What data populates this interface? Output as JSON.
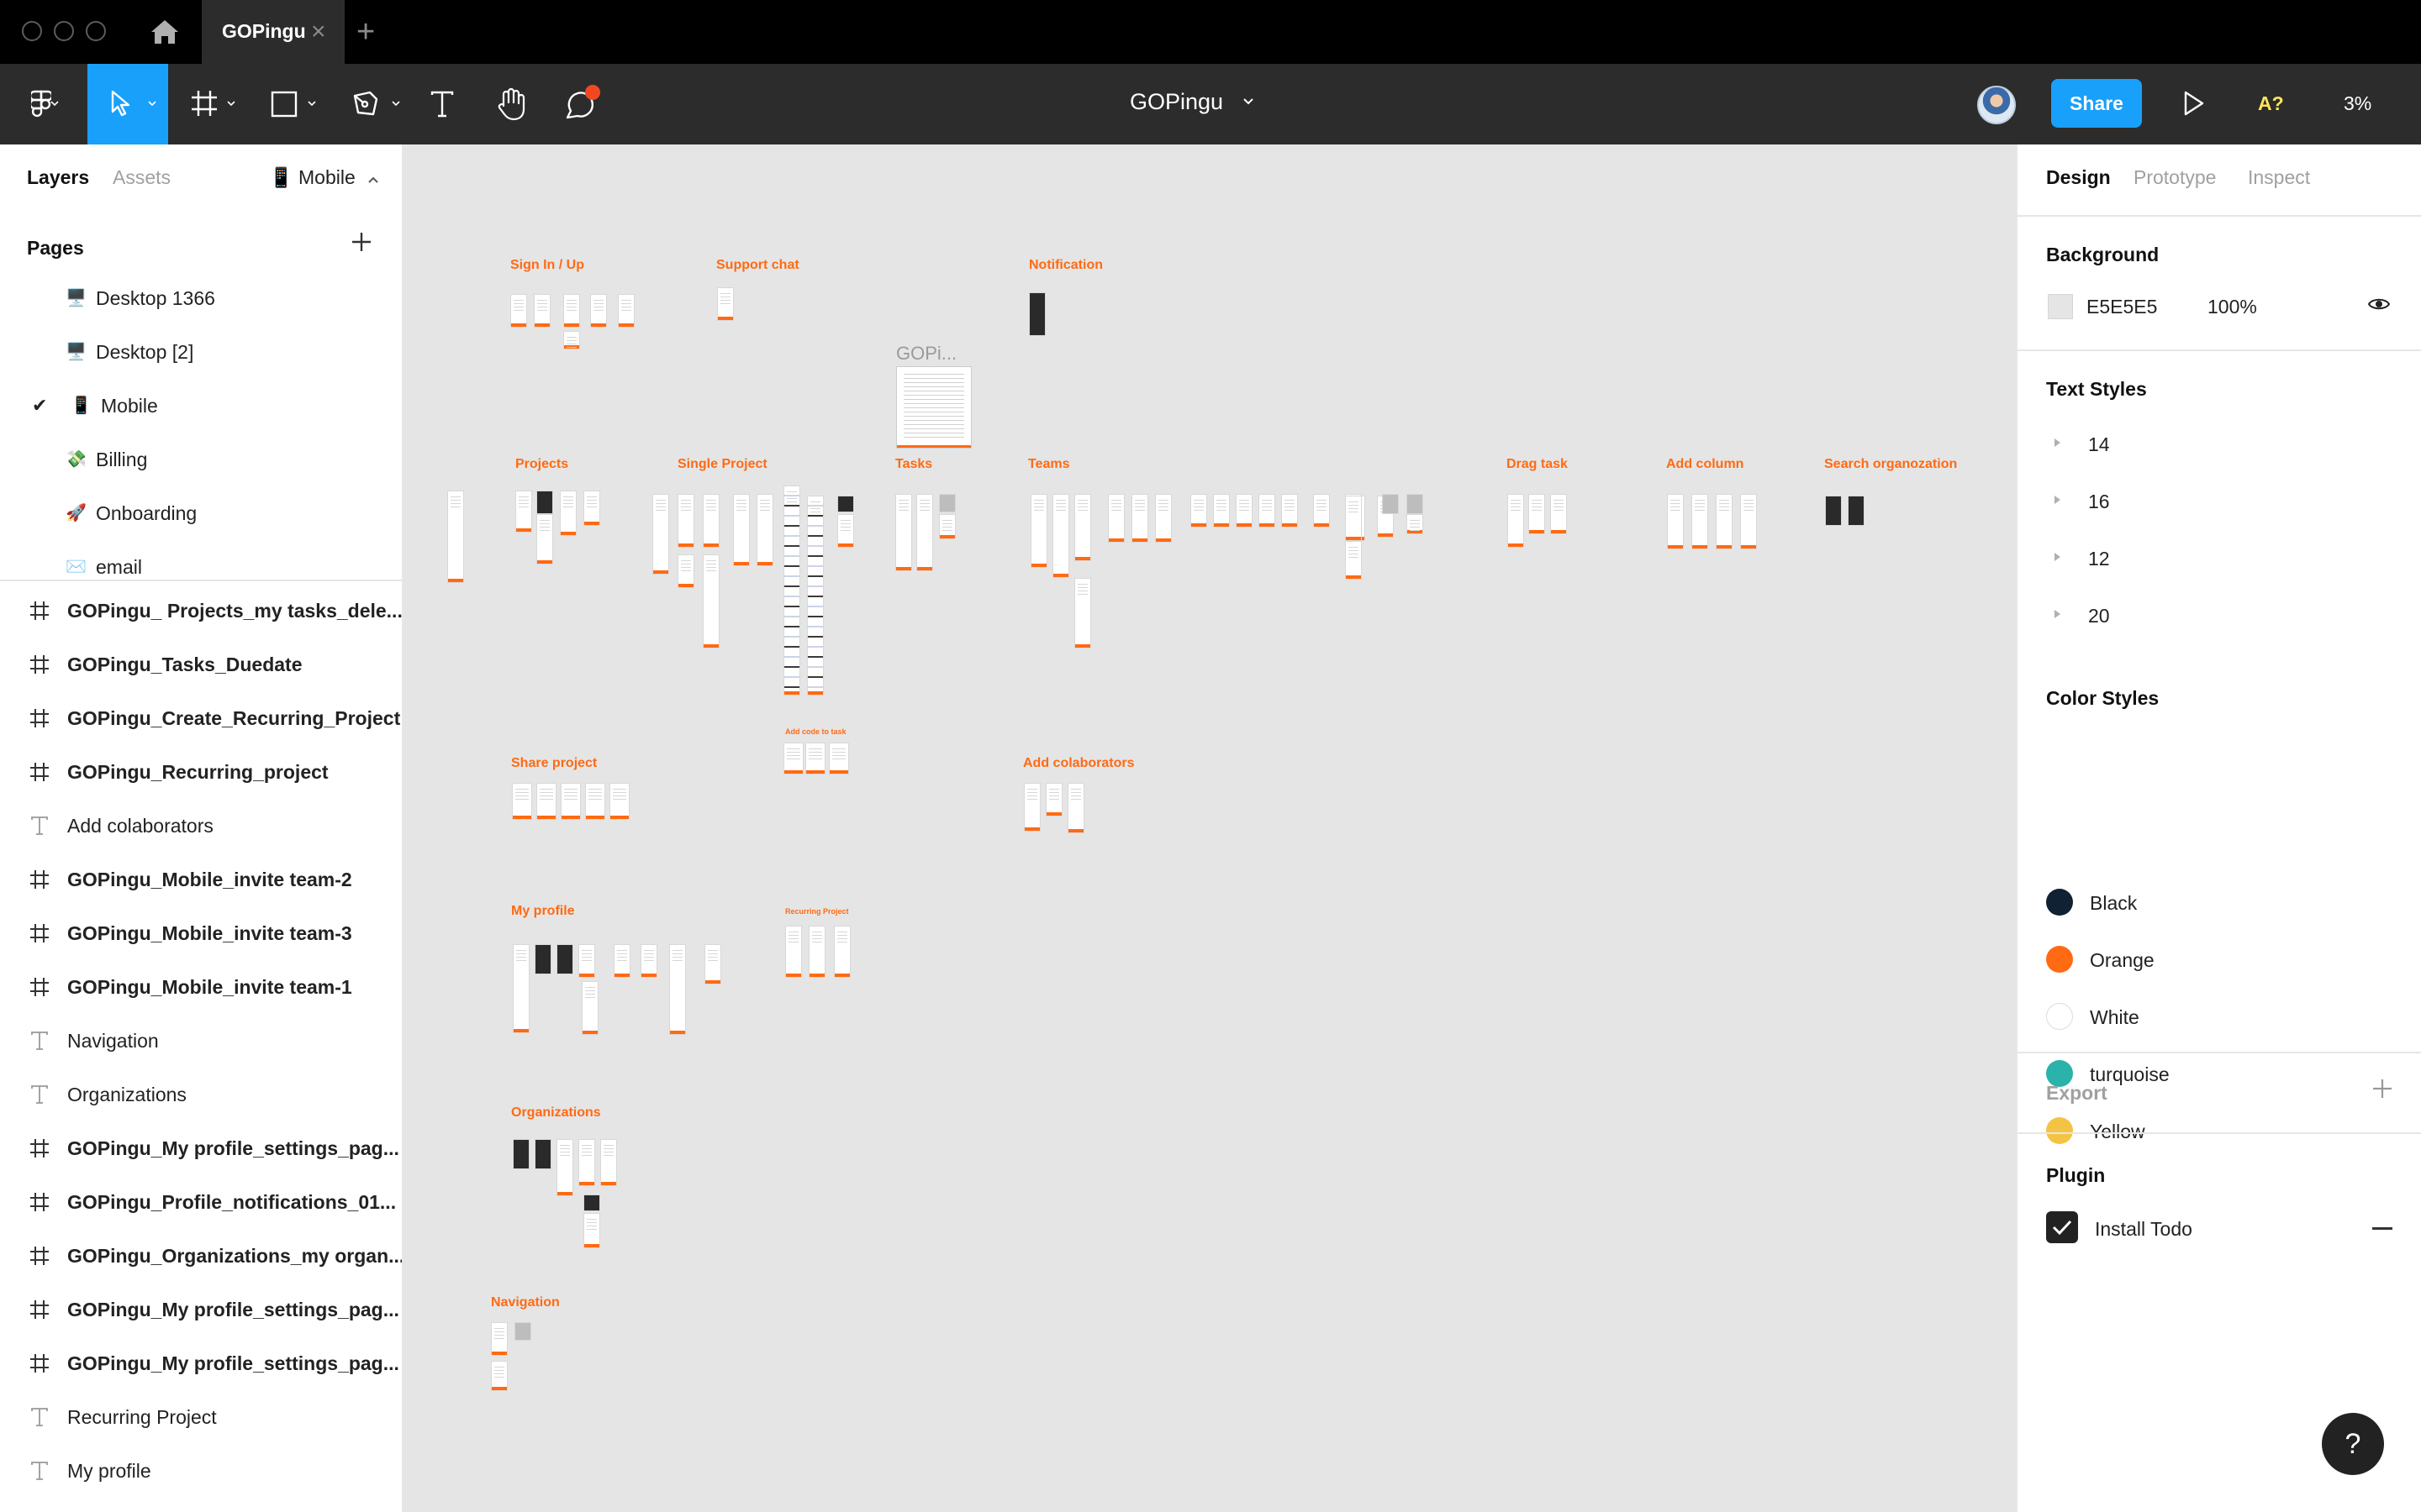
{
  "titlebar": {
    "tab_label": "GOPingu",
    "tab_close": "×",
    "new_tab": "+"
  },
  "toolbar": {
    "doc_title": "GOPingu",
    "share_label": "Share",
    "accessibility_label": "A?",
    "zoom": "3%",
    "tools": [
      "main-menu",
      "move",
      "frame",
      "shape",
      "pen",
      "text",
      "hand",
      "comment"
    ]
  },
  "left_panel": {
    "tabs": {
      "layers": "Layers",
      "assets": "Assets"
    },
    "page_switch": "📱 Mobile",
    "pages_header": "Pages",
    "pages": [
      {
        "emoji": "🖥️",
        "name": "Desktop 1366",
        "selected": false
      },
      {
        "emoji": "🖥️",
        "name": "Desktop [2]",
        "selected": false
      },
      {
        "emoji": "📱",
        "name": "Mobile",
        "selected": true
      },
      {
        "emoji": "💸",
        "name": "Billing",
        "selected": false
      },
      {
        "emoji": "🚀",
        "name": "Onboarding",
        "selected": false
      },
      {
        "emoji": "✉️",
        "name": "email",
        "selected": false
      }
    ],
    "check_mark": "✔",
    "layers": [
      {
        "type": "frame",
        "name": "GOPingu_ Projects_my tasks_dele..."
      },
      {
        "type": "frame",
        "name": "GOPingu_Tasks_Duedate"
      },
      {
        "type": "frame",
        "name": "GOPingu_Create_Recurring_Project"
      },
      {
        "type": "frame",
        "name": "GOPingu_Recurring_project"
      },
      {
        "type": "text",
        "name": "Add colaborators"
      },
      {
        "type": "frame",
        "name": "GOPingu_Mobile_invite team-2"
      },
      {
        "type": "frame",
        "name": "GOPingu_Mobile_invite team-3"
      },
      {
        "type": "frame",
        "name": "GOPingu_Mobile_invite team-1"
      },
      {
        "type": "text",
        "name": "Navigation"
      },
      {
        "type": "text",
        "name": "Organizations"
      },
      {
        "type": "frame",
        "name": "GOPingu_My profile_settings_pag..."
      },
      {
        "type": "frame",
        "name": "GOPingu_Profile_notifications_01..."
      },
      {
        "type": "frame",
        "name": "GOPingu_Organizations_my organ..."
      },
      {
        "type": "frame",
        "name": "GOPingu_My profile_settings_pag..."
      },
      {
        "type": "frame",
        "name": "GOPingu_My profile_settings_pag..."
      },
      {
        "type": "text",
        "name": "Recurring Project"
      },
      {
        "type": "text",
        "name": "My profile"
      }
    ]
  },
  "canvas": {
    "frame_label": "GOPi...",
    "sections": {
      "sign_in": "Sign In / Up",
      "support_chat": "Support chat",
      "notification": "Notification",
      "projects": "Projects",
      "single_project": "Single Project",
      "tasks": "Tasks",
      "teams": "Teams",
      "drag_task": "Drag task",
      "add_column": "Add column",
      "search_org": "Search organozation",
      "share_project": "Share project",
      "add_code": "Add code to task",
      "add_colaborators": "Add colaborators",
      "my_profile": "My profile",
      "recurring_project": "Recurring Project",
      "organizations": "Organizations",
      "navigation": "Navigation"
    }
  },
  "right_panel": {
    "tabs": {
      "design": "Design",
      "prototype": "Prototype",
      "inspect": "Inspect"
    },
    "background": {
      "header": "Background",
      "hex": "E5E5E5",
      "opacity": "100%",
      "color": "#E5E5E5"
    },
    "text_styles": {
      "header": "Text Styles",
      "items": [
        "14",
        "16",
        "12",
        "20"
      ]
    },
    "color_styles": {
      "header": "Color Styles",
      "items": [
        {
          "name": "Black",
          "color": "#0f2132"
        },
        {
          "name": "Orange",
          "color": "#ff6a13"
        },
        {
          "name": "White",
          "color": "#ffffff"
        },
        {
          "name": "turquoise",
          "color": "#2ab3aa"
        },
        {
          "name": "Yellow",
          "color": "#f3c444"
        }
      ]
    },
    "export_header": "Export",
    "plugin": {
      "header": "Plugin",
      "item": "Install Todo",
      "checked": true
    }
  },
  "help_label": "?",
  "colors": {
    "accent": "#18A0FB",
    "brand_orange": "#FF6A13",
    "toolbar": "#2C2C2C",
    "canvas": "#E5E5E5"
  }
}
